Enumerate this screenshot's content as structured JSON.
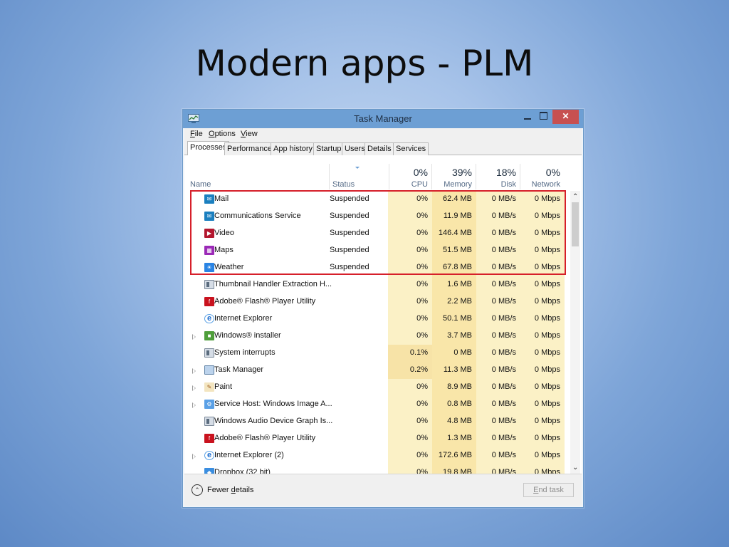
{
  "slide": {
    "title": "Modern apps - PLM"
  },
  "window": {
    "title": "Task Manager",
    "close_glyph": "✕"
  },
  "menu": [
    {
      "key": "F",
      "rest": "ile"
    },
    {
      "key": "O",
      "rest": "ptions"
    },
    {
      "key": "V",
      "rest": "iew"
    }
  ],
  "tabs": [
    "Processes",
    "Performance",
    "App history",
    "Startup",
    "Users",
    "Details",
    "Services"
  ],
  "columns": {
    "name": "Name",
    "status": "Status",
    "cpu": {
      "label": "CPU",
      "usage": "0%"
    },
    "memory": {
      "label": "Memory",
      "usage": "39%"
    },
    "disk": {
      "label": "Disk",
      "usage": "18%"
    },
    "network": {
      "label": "Network",
      "usage": "0%"
    }
  },
  "processes": [
    {
      "name": "Mail",
      "status": "Suspended",
      "cpu": "0%",
      "memory": "62.4 MB",
      "disk": "0 MB/s",
      "network": "0 Mbps",
      "icon": "mail-icon"
    },
    {
      "name": "Communications Service",
      "status": "Suspended",
      "cpu": "0%",
      "memory": "11.9 MB",
      "disk": "0 MB/s",
      "network": "0 Mbps",
      "icon": "communications-icon"
    },
    {
      "name": "Video",
      "status": "Suspended",
      "cpu": "0%",
      "memory": "146.4 MB",
      "disk": "0 MB/s",
      "network": "0 Mbps",
      "icon": "video-icon"
    },
    {
      "name": "Maps",
      "status": "Suspended",
      "cpu": "0%",
      "memory": "51.5 MB",
      "disk": "0 MB/s",
      "network": "0 Mbps",
      "icon": "maps-icon"
    },
    {
      "name": "Weather",
      "status": "Suspended",
      "cpu": "0%",
      "memory": "67.8 MB",
      "disk": "0 MB/s",
      "network": "0 Mbps",
      "icon": "weather-icon"
    },
    {
      "name": "Thumbnail Handler Extraction H...",
      "status": "",
      "cpu": "0%",
      "memory": "1.6 MB",
      "disk": "0 MB/s",
      "network": "0 Mbps",
      "icon": "generic-app-icon"
    },
    {
      "name": "Adobe® Flash® Player Utility",
      "status": "",
      "cpu": "0%",
      "memory": "2.2 MB",
      "disk": "0 MB/s",
      "network": "0 Mbps",
      "icon": "flash-icon"
    },
    {
      "name": "Internet Explorer",
      "status": "",
      "cpu": "0%",
      "memory": "50.1 MB",
      "disk": "0 MB/s",
      "network": "0 Mbps",
      "icon": "internet-explorer-icon"
    },
    {
      "name": "Windows® installer",
      "status": "",
      "cpu": "0%",
      "memory": "3.7 MB",
      "disk": "0 MB/s",
      "network": "0 Mbps",
      "icon": "installer-icon",
      "expandable": true
    },
    {
      "name": "System interrupts",
      "status": "",
      "cpu": "0.1%",
      "memory": "0 MB",
      "disk": "0 MB/s",
      "network": "0 Mbps",
      "icon": "generic-app-icon"
    },
    {
      "name": "Task Manager",
      "status": "",
      "cpu": "0.2%",
      "memory": "11.3 MB",
      "disk": "0 MB/s",
      "network": "0 Mbps",
      "icon": "task-manager-icon",
      "expandable": true
    },
    {
      "name": "Paint",
      "status": "",
      "cpu": "0%",
      "memory": "8.9 MB",
      "disk": "0 MB/s",
      "network": "0 Mbps",
      "icon": "paint-icon",
      "expandable": true
    },
    {
      "name": "Service Host: Windows Image A...",
      "status": "",
      "cpu": "0%",
      "memory": "0.8 MB",
      "disk": "0 MB/s",
      "network": "0 Mbps",
      "icon": "service-host-icon",
      "expandable": true
    },
    {
      "name": "Windows Audio Device Graph Is...",
      "status": "",
      "cpu": "0%",
      "memory": "4.8 MB",
      "disk": "0 MB/s",
      "network": "0 Mbps",
      "icon": "generic-app-icon"
    },
    {
      "name": "Adobe® Flash® Player Utility",
      "status": "",
      "cpu": "0%",
      "memory": "1.3 MB",
      "disk": "0 MB/s",
      "network": "0 Mbps",
      "icon": "flash-icon"
    },
    {
      "name": "Internet Explorer (2)",
      "status": "",
      "cpu": "0%",
      "memory": "172.6 MB",
      "disk": "0 MB/s",
      "network": "0 Mbps",
      "icon": "internet-explorer-icon",
      "expandable": true
    },
    {
      "name": "Dropbox (32 bit)",
      "status": "",
      "cpu": "0%",
      "memory": "19.8 MB",
      "disk": "0 MB/s",
      "network": "0 Mbps",
      "icon": "dropbox-icon"
    }
  ],
  "footer": {
    "fewer_details_pre": "Fewer ",
    "fewer_details_key": "d",
    "fewer_details_post": "etails",
    "end_task_key": "E",
    "end_task_rest": "nd task"
  },
  "colors": {
    "titlebar": "#6d9fd4",
    "close_button": "#c75050",
    "highlight_box": "#d61f2a",
    "cpu_heat": "#fbf1c6",
    "memory_heat": "#f9e6a9"
  }
}
